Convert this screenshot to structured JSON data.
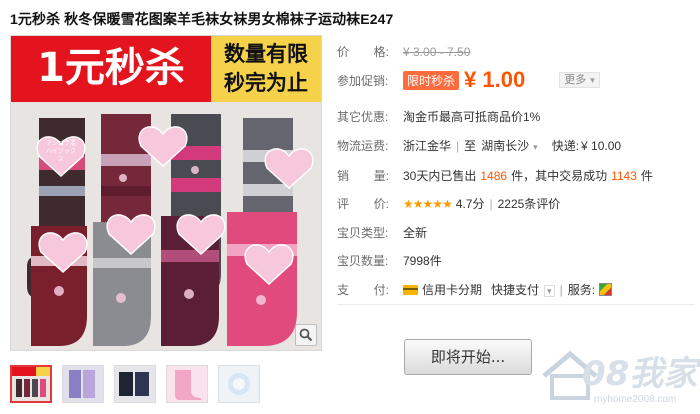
{
  "product": {
    "title": "1元秒杀 秋冬保暖雪花图案羊毛袜女袜男女棉袜子运动袜E247",
    "image_banner_left": "1元秒杀",
    "image_banner_right_1": "数量有限",
    "image_banner_right_2": "秒完为止",
    "tag_text": "アンゴラ混 ハイソックス"
  },
  "labels": {
    "price_a": "价",
    "price_b": "格:",
    "promo": "参加促销:",
    "other": "其它优惠:",
    "shipping": "物流运费:",
    "sales_a": "销",
    "sales_b": "量:",
    "rating_a": "评",
    "rating_b": "价:",
    "type": "宝贝类型:",
    "qty": "宝贝数量:",
    "pay_a": "支",
    "pay_b": "付:"
  },
  "price": {
    "original": "¥ 3.00 - 7.50"
  },
  "promo": {
    "tag": "限时秒杀",
    "price": "¥ 1.00",
    "more": "更多"
  },
  "other_offer": "淘金币最高可抵商品价1%",
  "shipping": {
    "from": "浙江金华",
    "sep": "至",
    "to": "湖南长沙",
    "express_label": "快递:",
    "express_price": "¥ 10.00"
  },
  "sales": {
    "prefix": "30天内已售出",
    "sold": "1486",
    "mid": "件，其中交易成功",
    "success": "1143",
    "suffix": "件"
  },
  "rating": {
    "stars": "★★★★★",
    "score": "4.7分",
    "sep": "|",
    "reviews": "2225条评价"
  },
  "item_type": "全新",
  "item_qty": "7998件",
  "payment": {
    "credit": "信用卡分期",
    "quick": "快捷支付",
    "service_label": "服务:"
  },
  "buy_button": "即将开始...",
  "watermark": {
    "main": "08我家",
    "sub": "myhome2008.com"
  },
  "icons": {
    "zoom": "magnifier-icon",
    "credit": "credit-card-icon",
    "service": "service-badge-icon",
    "caret": "chevron-down-icon"
  }
}
